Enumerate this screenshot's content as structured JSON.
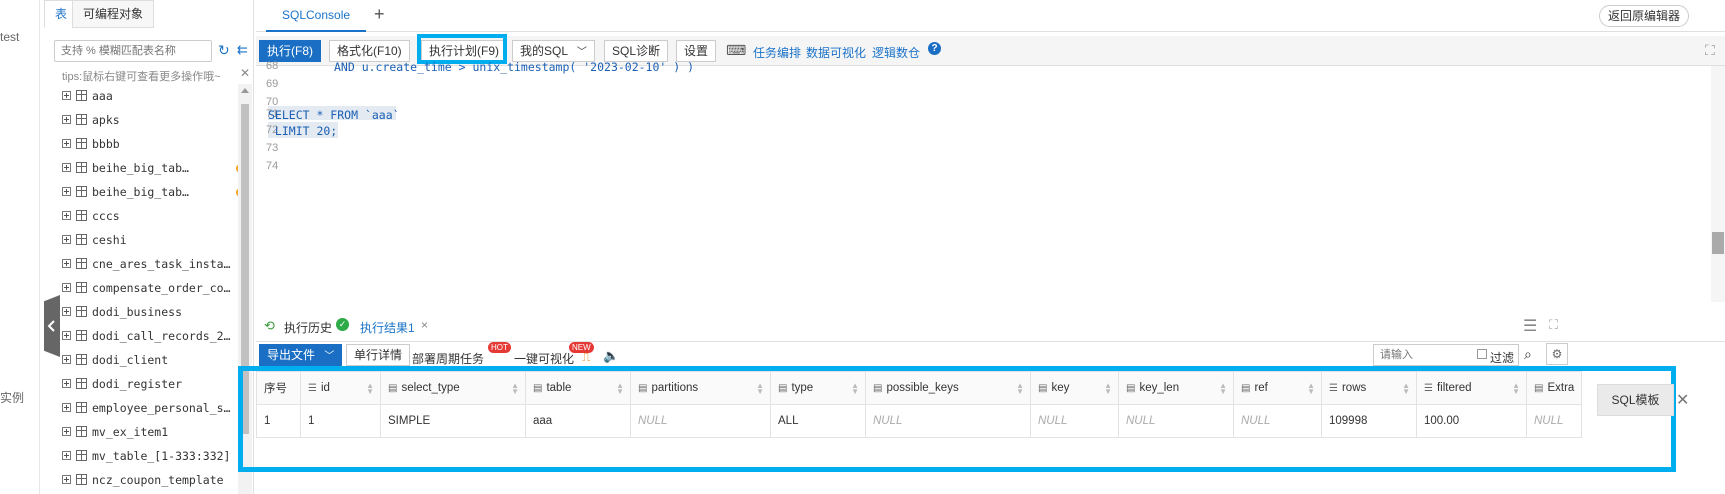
{
  "left_strip": {
    "top_text": "test",
    "bottom_text": "实例"
  },
  "tree": {
    "tab_tables": "表",
    "tab_programmable": "可编程对象",
    "search_placeholder": "支持 % 模糊匹配表名称",
    "tips": "tips:鼠标右键可查看更多操作哦~",
    "items": [
      {
        "name": "aaa",
        "warn": false
      },
      {
        "name": "apks",
        "warn": false
      },
      {
        "name": "bbbb",
        "warn": false
      },
      {
        "name": "beihe_big_tab…",
        "warn": true
      },
      {
        "name": "beihe_big_tab…",
        "warn": true
      },
      {
        "name": "cccs",
        "warn": false
      },
      {
        "name": "ceshi",
        "warn": false
      },
      {
        "name": "cne_ares_task_insta…",
        "warn": false
      },
      {
        "name": "compensate_order_co…",
        "warn": false
      },
      {
        "name": "dodi_business",
        "warn": false
      },
      {
        "name": "dodi_call_records_2…",
        "warn": false
      },
      {
        "name": "dodi_client",
        "warn": false
      },
      {
        "name": "dodi_register",
        "warn": false
      },
      {
        "name": "employee_personal_s…",
        "warn": false
      },
      {
        "name": "mv_ex_item1",
        "warn": false
      },
      {
        "name": "mv_table_[1-333:332]",
        "warn": false
      },
      {
        "name": "ncz_coupon_template",
        "warn": false
      }
    ]
  },
  "tabs": {
    "console": "SQLConsole",
    "add": "+",
    "back_button": "返回原编辑器"
  },
  "toolbar": {
    "execute": "执行(F8)",
    "format": "格式化(F10)",
    "plan": "执行计划(F9)",
    "my_sql": "我的SQL",
    "diagnose": "SQL诊断",
    "settings": "设置",
    "task_schedule": "任务编排",
    "visualize": "数据可视化",
    "logic_warehouse": "逻辑数仓"
  },
  "editor": {
    "lines": [
      {
        "num": "68",
        "kind": "partial",
        "text": "AND u.create_time > unix_timestamp( '2023-02-10' ) )"
      },
      {
        "num": "69",
        "kind": "blank",
        "text": ""
      },
      {
        "num": "70",
        "kind": "blank",
        "text": ""
      },
      {
        "num": "71",
        "kind": "select",
        "text": "SELECT * FROM `aaa`"
      },
      {
        "num": "72",
        "kind": "limit",
        "text": " LIMIT 20;"
      },
      {
        "num": "73",
        "kind": "blank",
        "text": ""
      },
      {
        "num": "74",
        "kind": "blank",
        "text": ""
      }
    ]
  },
  "results": {
    "history_tab": "执行历史",
    "result_tab": "执行结果1",
    "export": "导出文件",
    "row_detail": "单行详情",
    "deploy_task": "部署周期任务",
    "hot_badge": "HOT",
    "one_click_viz": "一键可视化",
    "new_badge": "NEW",
    "filter_placeholder": "请输入",
    "filter_label": "过滤",
    "columns": [
      "序号",
      "id",
      "select_type",
      "table",
      "partitions",
      "type",
      "possible_keys",
      "key",
      "key_len",
      "ref",
      "rows",
      "filtered",
      "Extra"
    ],
    "rows": [
      [
        "1",
        "1",
        "SIMPLE",
        "aaa",
        "NULL",
        "ALL",
        "NULL",
        "NULL",
        "NULL",
        "NULL",
        "109998",
        "100.00",
        "NULL"
      ]
    ]
  },
  "sql_template": "SQL模板",
  "colors": {
    "accent": "#1a73c8",
    "highlight": "#00aeef",
    "warn": "#f5a623",
    "badge": "#e53935"
  }
}
